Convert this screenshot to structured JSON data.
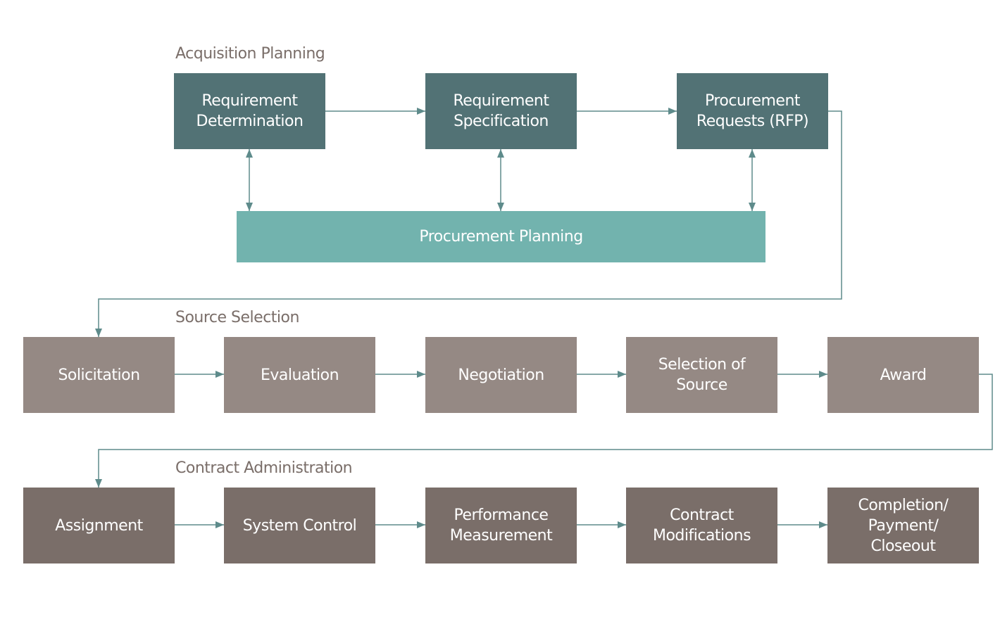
{
  "colors": {
    "acquisition": "#527275",
    "planning": "#72B3AE",
    "source": "#958984",
    "contract": "#7A6E69",
    "connector": "#5E8B8B"
  },
  "sections": {
    "acquisition": {
      "label": "Acquisition Planning",
      "steps": [
        "Requirement\nDetermination",
        "Requirement\nSpecification",
        "Procurement\nRequests (RFP)"
      ],
      "base": "Procurement Planning"
    },
    "source": {
      "label": "Source Selection",
      "steps": [
        "Solicitation",
        "Evaluation",
        "Negotiation",
        "Selection of\nSource",
        "Award"
      ]
    },
    "contract": {
      "label": "Contract Administration",
      "steps": [
        "Assignment",
        "System Control",
        "Performance\nMeasurement",
        "Contract\nModifications",
        "Completion/\nPayment/\nCloseout"
      ]
    }
  }
}
